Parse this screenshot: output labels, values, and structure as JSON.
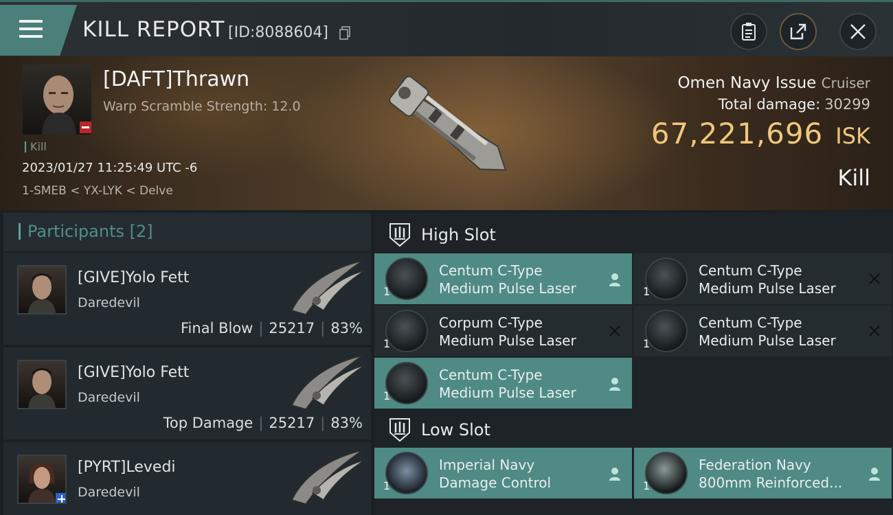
{
  "header": {
    "title": "KILL REPORT",
    "report_id": "[ID:8088604]"
  },
  "victim": {
    "name": "[DAFT]Thrawn",
    "warp_scramble": "Warp Scramble Strength: 12.0",
    "kill_tag": "Kill",
    "datetime": "2023/01/27 11:25:49 UTC -6",
    "location": "1-SMEB < YX-LYK < Delve",
    "ship_name": "Omen Navy Issue",
    "ship_class": "Cruiser",
    "total_damage_label": "Total damage:",
    "total_damage_value": "30299",
    "isk_value": "67,221,696",
    "isk_unit": "ISK",
    "result": "Kill"
  },
  "participants": {
    "label": "Participants",
    "count": "[2]",
    "rows": [
      {
        "name": "[GIVE]Yolo Fett",
        "ship": "Daredevil",
        "tag": "Final Blow",
        "damage": "25217",
        "percent": "83%"
      },
      {
        "name": "[GIVE]Yolo Fett",
        "ship": "Daredevil",
        "tag": "Top Damage",
        "damage": "25217",
        "percent": "83%"
      },
      {
        "name": "[PYRT]Levedi",
        "ship": "Daredevil",
        "tag": "",
        "damage": "",
        "percent": ""
      }
    ]
  },
  "fitting": {
    "high_slot_label": "High Slot",
    "low_slot_label": "Low Slot",
    "high": [
      {
        "line1": "Centum C-Type",
        "line2": "Medium Pulse Laser",
        "qty": "1",
        "dropped": true
      },
      {
        "line1": "Centum C-Type",
        "line2": "Medium Pulse Laser",
        "qty": "1",
        "dropped": false
      },
      {
        "line1": "Corpum C-Type",
        "line2": "Medium Pulse Laser",
        "qty": "1",
        "dropped": false
      },
      {
        "line1": "Centum C-Type",
        "line2": "Medium Pulse Laser",
        "qty": "1",
        "dropped": false
      },
      {
        "line1": "Centum C-Type",
        "line2": "Medium Pulse Laser",
        "qty": "1",
        "dropped": true
      }
    ],
    "low": [
      {
        "line1": "Imperial Navy",
        "line2": "Damage Control",
        "qty": "1",
        "dropped": true
      },
      {
        "line1": "Federation Navy",
        "line2": "800mm Reinforced...",
        "qty": "1",
        "dropped": true
      }
    ]
  },
  "colors": {
    "accent": "#4f8a84",
    "isk": "#f0c77a",
    "badge_red": "#b8262a",
    "badge_blue": "#2a66c9"
  },
  "icons": [
    "menu-icon",
    "copy-icon",
    "clipboard-icon",
    "share-icon",
    "close-icon",
    "person-icon",
    "x-mark-icon",
    "high-slot-icon",
    "low-slot-icon"
  ]
}
